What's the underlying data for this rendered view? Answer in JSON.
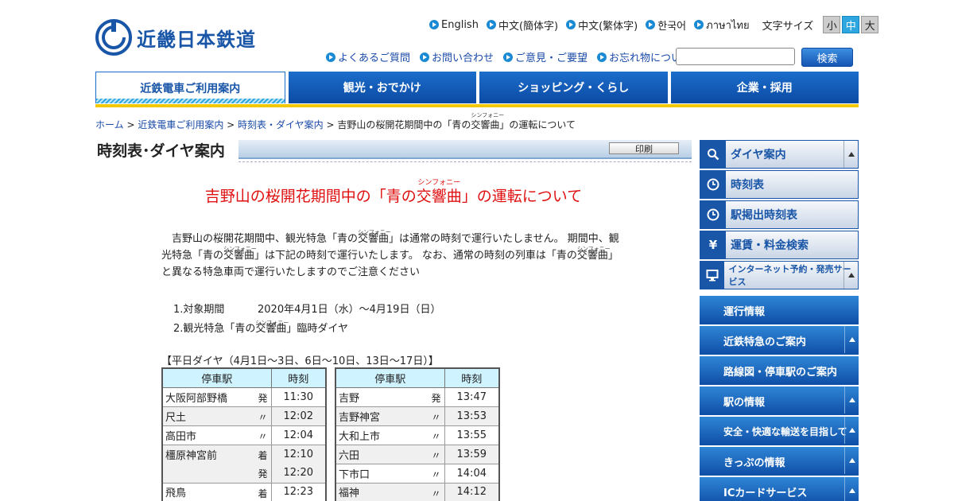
{
  "header": {
    "logo_text": "近畿日本鉄道",
    "languages": [
      "English",
      "中文(簡体字)",
      "中文(繁体字)",
      "한국어",
      "ภาษาไทย"
    ],
    "font_size_label": "文字サイズ",
    "font_sizes": [
      "小",
      "中",
      "大"
    ],
    "utility_links": [
      "よくあるご質問",
      "お問い合わせ",
      "ご意見・ご要望",
      "お忘れ物について"
    ],
    "search_button": "検索",
    "search_placeholder": ""
  },
  "nav": {
    "items": [
      "近鉄電車ご利用案内",
      "観光・おでかけ",
      "ショッピング・くらし",
      "企業・採用"
    ]
  },
  "breadcrumb": {
    "home": "ホーム",
    "sep": " > ",
    "level1": "近鉄電車ご利用案内",
    "level2": "時刻表・ダイヤ案内",
    "current_pre": "吉野山の桜開花期間中の「青の",
    "current_ruby_base": "交響曲",
    "current_ruby": "シンフォニー",
    "current_post": "」の運転について"
  },
  "section": {
    "title": "時刻表･ダイヤ案内",
    "print": "印刷"
  },
  "article": {
    "heading_pre": "吉野山の桜開花期間中の「青の",
    "heading_ruby_base": "交響曲",
    "heading_ruby": "シンフォニー",
    "heading_post": "」の運転について",
    "para_1": "　吉野山の桜開花期間中、観光特急「青の",
    "para_ruby_base": "交響曲",
    "para_ruby": "シンフォニー",
    "para_2": "」は通常の時刻で運行いたしません。 期間中、観",
    "para_3": "光特急「青の",
    "para_4": "」は下記の時刻で運行いたします。 なお、通常の時刻の列車は「青の",
    "para_5": "」",
    "para_6": "と異なる特急車両で運行いたしますのでご注意ください",
    "list_1_label": "1.対象期間",
    "list_1_value": "2020年4月1日（水）～4月19日（日）",
    "list_2_pre": "2.観光特急「青の",
    "list_2_post": "」臨時ダイヤ",
    "table_title": "【平日ダイヤ（4月1日～3日、6日～10日、13日～17日）】"
  },
  "table_left": {
    "headers": [
      "停車駅",
      "時刻"
    ],
    "rows": [
      {
        "station": "大阪阿部野橋",
        "mark": "発",
        "time": "11:30"
      },
      {
        "station": "尺土",
        "mark": "〃",
        "time": "12:02"
      },
      {
        "station": "高田市",
        "mark": "〃",
        "time": "12:04"
      },
      {
        "station": "橿原神宮前",
        "mark": "着",
        "time": "12:10"
      },
      {
        "station": "",
        "mark": "発",
        "time": "12:20"
      },
      {
        "station": "飛鳥",
        "mark": "着",
        "time": "12:23"
      }
    ]
  },
  "table_right": {
    "headers": [
      "停車駅",
      "時刻"
    ],
    "rows": [
      {
        "station": "吉野",
        "mark": "発",
        "time": "13:47"
      },
      {
        "station": "吉野神宮",
        "mark": "〃",
        "time": "13:53"
      },
      {
        "station": "大和上市",
        "mark": "〃",
        "time": "13:55"
      },
      {
        "station": "六田",
        "mark": "〃",
        "time": "13:59"
      },
      {
        "station": "下市口",
        "mark": "〃",
        "time": "14:04"
      },
      {
        "station": "福神",
        "mark": "〃",
        "time": "14:12"
      }
    ]
  },
  "sidebar": {
    "top_items": [
      {
        "label": "ダイヤ案内",
        "icon": "search-icon"
      },
      {
        "label": "時刻表",
        "icon": "clock-icon"
      },
      {
        "label": "駅掲出時刻表",
        "icon": "clock-icon"
      },
      {
        "label": "運賃・料金検索",
        "icon": "yen-icon"
      },
      {
        "label": "インターネット予約・発売サービス",
        "icon": "monitor-icon"
      }
    ],
    "blue_items": [
      "運行情報",
      "近鉄特急のご案内",
      "路線図・停車駅のご案内",
      "駅の情報",
      "安全・快適な輸送を目指して",
      "きっぷの情報",
      "ICカードサービス"
    ]
  },
  "colors": {
    "brand_blue": "#1a56a8",
    "heading_red": "#e01010",
    "accent_yellow": "#f3c800",
    "table_header": "#cff3ff"
  }
}
